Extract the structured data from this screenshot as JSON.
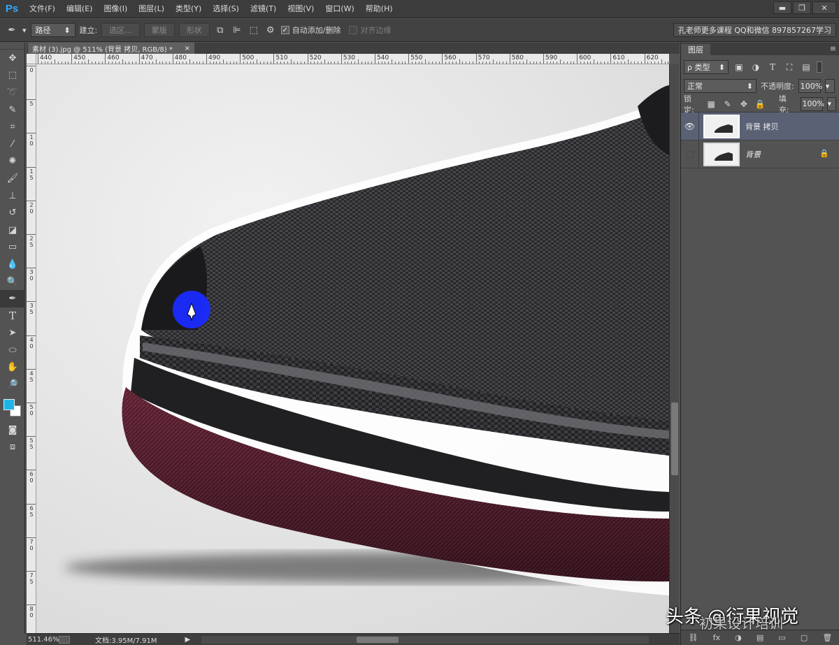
{
  "app": {
    "logo": "Ps"
  },
  "menu": [
    "文件(F)",
    "编辑(E)",
    "图像(I)",
    "图层(L)",
    "类型(Y)",
    "选择(S)",
    "滤镜(T)",
    "视图(V)",
    "窗口(W)",
    "帮助(H)"
  ],
  "window_controls": {
    "minimize": "▬",
    "restore": "❐",
    "close": "✕"
  },
  "options": {
    "tool_icon": "pen-icon",
    "mode": "路径",
    "make_label": "建立:",
    "selection_btn": "选区...",
    "mask_btn": "蒙版",
    "shape_btn": "形状",
    "auto_add_delete": "自动添加/删除",
    "auto_add_checked": "✓",
    "align_edges": "对齐边缘"
  },
  "promo": "孔老师更多课程 QQ和微信 897857267学习",
  "document": {
    "tab_title": "素材 (3).jpg @ 511% (背景 拷贝, RGB/8) *",
    "close": "×"
  },
  "ruler": {
    "top_labels": [
      "440",
      "450",
      "460",
      "470",
      "480",
      "490",
      "500",
      "510",
      "520",
      "530",
      "540",
      "550",
      "560",
      "570",
      "580",
      "590",
      "600",
      "610",
      "620"
    ],
    "left_labels": [
      "0",
      "5",
      "1 0",
      "1 5",
      "2 0",
      "2 5",
      "3 0",
      "3 5",
      "4 0",
      "4 5",
      "5 0",
      "5 5",
      "6 0",
      "6 5",
      "7 0",
      "7 5",
      "8 0",
      "8 5"
    ]
  },
  "status": {
    "zoom": "511.46%",
    "doc": "文档:3.95M/7.91M",
    "arrow": "▶"
  },
  "colors": {
    "foreground": "#1fb4e8",
    "background": "#ffffff",
    "selected_layer": "#5b6175",
    "cursor_dot": "#1a2bff"
  },
  "layers_panel": {
    "tab": "图层",
    "menu": "≡",
    "filter_kind": "ρ 类型",
    "blend_mode": "正常",
    "opacity_label": "不透明度:",
    "opacity_value": "100%",
    "lock_label": "锁定:",
    "fill_label": "填充:",
    "fill_value": "100%",
    "layers": [
      {
        "name": "背景 拷贝",
        "visible": true,
        "selected": true
      },
      {
        "name": "背景",
        "visible": false,
        "selected": false,
        "locked": true
      }
    ],
    "bottom_icons": [
      "⛓",
      "fx",
      "◑",
      "▤",
      "▭",
      "▢",
      "🗑"
    ]
  },
  "watermark": {
    "line1": "头条 @衍果视觉",
    "line2": "初果设计培训"
  }
}
